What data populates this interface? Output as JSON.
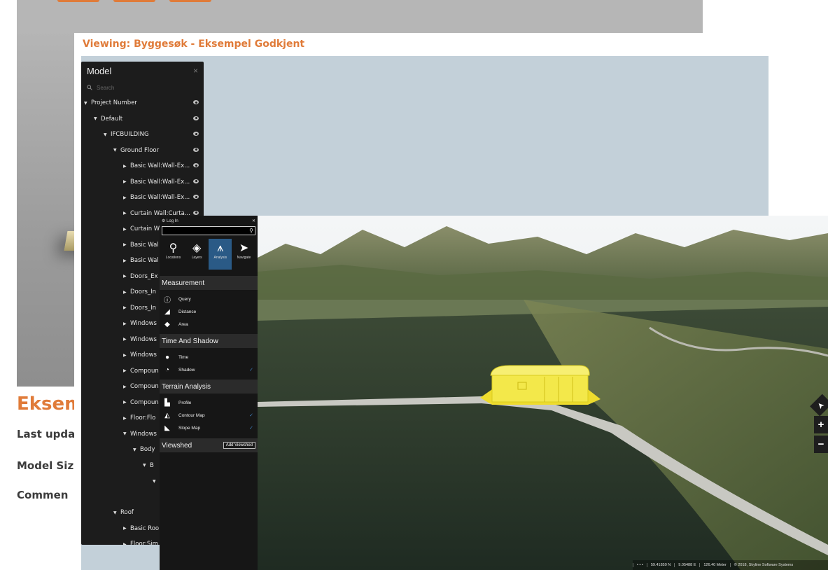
{
  "back_window": {
    "heading": "Eksem",
    "meta": [
      "Last upda",
      "Model Siz",
      "Commen"
    ],
    "side_tab_glyph": "›"
  },
  "middle_window": {
    "title": "Viewing: Byggesøk - Eksempel Godkjent"
  },
  "model_panel": {
    "title": "Model",
    "close_glyph": "×",
    "search_placeholder": "Search",
    "tree": [
      {
        "label": "Project Number",
        "arrow": "down",
        "eye": true
      },
      {
        "label": "Default",
        "arrow": "down",
        "eye": true
      },
      {
        "label": "IFCBUILDING",
        "arrow": "down",
        "eye": true
      },
      {
        "label": "Ground Floor",
        "arrow": "down",
        "eye": true
      },
      {
        "label": "Basic Wall:Wall-Ex...",
        "arrow": "right",
        "eye": true
      },
      {
        "label": "Basic Wall:Wall-Ex...",
        "arrow": "right",
        "eye": true
      },
      {
        "label": "Basic Wall:Wall-Ex...",
        "arrow": "right",
        "eye": true
      },
      {
        "label": "Curtain Wall:Curta...",
        "arrow": "right",
        "eye": true
      },
      {
        "label": "Curtain W",
        "arrow": "right",
        "eye": false
      },
      {
        "label": "Basic Wal",
        "arrow": "right",
        "eye": false
      },
      {
        "label": "Basic Wal",
        "arrow": "right",
        "eye": false
      },
      {
        "label": "Doors_Ex",
        "arrow": "right",
        "eye": false
      },
      {
        "label": "Doors_In",
        "arrow": "right",
        "eye": false
      },
      {
        "label": "Doors_In",
        "arrow": "right",
        "eye": false
      },
      {
        "label": "Windows",
        "arrow": "right",
        "eye": false
      },
      {
        "label": "Windows",
        "arrow": "right",
        "eye": false
      },
      {
        "label": "Windows",
        "arrow": "right",
        "eye": false
      },
      {
        "label": "Compoun",
        "arrow": "right",
        "eye": false
      },
      {
        "label": "Compoun",
        "arrow": "right",
        "eye": false
      },
      {
        "label": "Compoun",
        "arrow": "right",
        "eye": false
      },
      {
        "label": "Floor:Flo",
        "arrow": "right",
        "eye": false
      },
      {
        "label": "Windows",
        "arrow": "down",
        "eye": false
      },
      {
        "label": "Body",
        "arrow": "down",
        "eye": false
      },
      {
        "label": "B",
        "arrow": "down",
        "eye": false
      },
      {
        "label": "",
        "arrow": "down",
        "eye": false
      },
      {
        "label": "",
        "arrow": "none",
        "eye": false
      },
      {
        "label": "Roof",
        "arrow": "down",
        "eye": false
      },
      {
        "label": "Basic Roo",
        "arrow": "right",
        "eye": false
      },
      {
        "label": "Floor:Sim",
        "arrow": "right",
        "eye": false
      }
    ]
  },
  "analysis_panel": {
    "login_label": "Log In",
    "close_glyph": "✕",
    "search_icon": "search-icon",
    "tabs": [
      {
        "label": "Locations",
        "icon": "pin-icon",
        "glyph": "⚲",
        "active": false
      },
      {
        "label": "Layers",
        "icon": "layers-icon",
        "glyph": "◈",
        "active": false
      },
      {
        "label": "Analysis",
        "icon": "compass-icon",
        "glyph": "⩚",
        "active": true
      },
      {
        "label": "Navigate",
        "icon": "navigate-icon",
        "glyph": "➤",
        "active": false
      }
    ],
    "sections": [
      {
        "title": "Measurement",
        "items": [
          {
            "label": "Query",
            "icon": "query-icon",
            "glyph": "ⓘ",
            "checked": false
          },
          {
            "label": "Distance",
            "icon": "distance-icon",
            "glyph": "◢",
            "checked": false
          },
          {
            "label": "Area",
            "icon": "area-icon",
            "glyph": "◆",
            "checked": false
          }
        ]
      },
      {
        "title": "Time And Shadow",
        "items": [
          {
            "label": "Time",
            "icon": "clock-icon",
            "glyph": "●",
            "checked": false
          },
          {
            "label": "Shadow",
            "icon": "shadow-icon",
            "glyph": "◔",
            "checked": true
          }
        ]
      },
      {
        "title": "Terrain Analysis",
        "items": [
          {
            "label": "Profile",
            "icon": "profile-icon",
            "glyph": "▙",
            "checked": false
          },
          {
            "label": "Contour Map",
            "icon": "contour-icon",
            "glyph": "◭",
            "checked": true
          },
          {
            "label": "Slope Map",
            "icon": "slope-icon",
            "glyph": "◣",
            "checked": true
          }
        ]
      }
    ],
    "viewshed": {
      "title": "Viewshed",
      "add_label": "Add Viewshed"
    },
    "check_glyph": "✓"
  },
  "globe_view": {
    "tools": [
      {
        "name": "navigate-arrow-icon",
        "glyph": "➤"
      },
      {
        "name": "zoom-in-button",
        "glyph": "+"
      },
      {
        "name": "zoom-out-button",
        "glyph": "−"
      }
    ],
    "status": [
      "• • •",
      "59.41859 N",
      "9.05488 E",
      "126.40 Meter",
      "© 2018, Skyline Software Systems"
    ],
    "building_color": "#f3e84a"
  },
  "colors": {
    "accent_orange": "#e07b39",
    "panel_dark": "#1c1c1c",
    "active_tab_blue": "#2a5a86",
    "check_blue": "#3d7fbf"
  }
}
